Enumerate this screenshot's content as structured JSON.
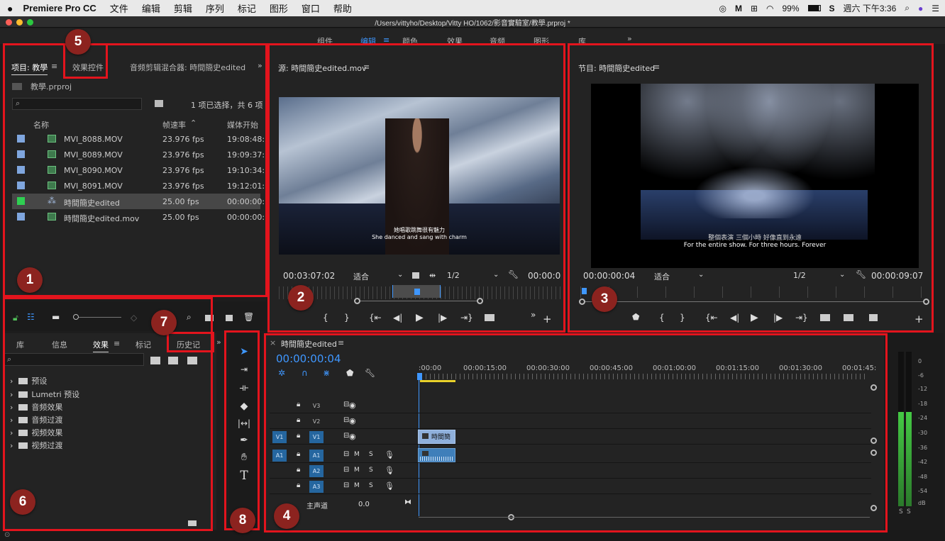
{
  "menubar": {
    "app": "Premiere Pro CC",
    "items": [
      "文件",
      "编辑",
      "剪辑",
      "序列",
      "标记",
      "图形",
      "窗口",
      "帮助"
    ],
    "battery": "99%",
    "clock": "週六 下午3:36"
  },
  "window": {
    "title": "/Users/vittyho/Desktop/Vitty HO/1062/影音實驗室/教學.prproj *"
  },
  "workspaces": [
    "组件",
    "编辑",
    "颜色",
    "效果",
    "音频",
    "图形",
    "库"
  ],
  "project": {
    "tabs": [
      "项目: 教學",
      "效果控件",
      "音频剪辑混合器: 時間簡史edited"
    ],
    "file": "教學.prproj",
    "search_placeholder": "",
    "selection_info": "1 项已选择，共 6 项",
    "columns": [
      "名称",
      "帧速率",
      "媒体开始"
    ],
    "rows": [
      {
        "name": "MVI_8088.MOV",
        "fps": "23.976 fps",
        "start": "19:08:48:"
      },
      {
        "name": "MVI_8089.MOV",
        "fps": "23.976 fps",
        "start": "19:09:37:"
      },
      {
        "name": "MVI_8090.MOV",
        "fps": "23.976 fps",
        "start": "19:10:34:"
      },
      {
        "name": "MVI_8091.MOV",
        "fps": "23.976 fps",
        "start": "19:12:01:"
      },
      {
        "name": "時間簡史edited",
        "fps": "25.00 fps",
        "start": "00:00:00:"
      },
      {
        "name": "時間簡史edited.mov",
        "fps": "25.00 fps",
        "start": "00:00:00:"
      }
    ]
  },
  "source": {
    "title": "源: 時間簡史edited.mov",
    "timecode": "00:03:07:02",
    "fit": "适合",
    "resolution": "1/2",
    "duration": "00:00:0",
    "subtitle_zh": "她唱歌跳舞很有魅力",
    "subtitle_en": "She danced and sang with charm"
  },
  "program": {
    "title": "节目: 時間簡史edited",
    "timecode": "00:00:00:04",
    "fit": "适合",
    "resolution": "1/2",
    "duration": "00:00:09:07",
    "subtitle_zh": "整個表演 三個小時 好像直到永遠",
    "subtitle_en": "For the entire show. For three hours. Forever"
  },
  "effects": {
    "tabs": [
      "库",
      "信息",
      "效果",
      "标记",
      "历史记"
    ],
    "folders": [
      "预设",
      "Lumetri 预设",
      "音频效果",
      "音频过渡",
      "视频效果",
      "视频过渡"
    ]
  },
  "timeline": {
    "title": "時間簡史edited",
    "timecode": "00:00:00:04",
    "ruler": [
      ":00:00",
      "00:00:15:00",
      "00:00:30:00",
      "00:00:45:00",
      "00:01:00:00",
      "00:01:15:00",
      "00:01:30:00",
      "00:01:45:"
    ],
    "video_tracks": [
      "V3",
      "V2",
      "V1"
    ],
    "audio_tracks": [
      "A1",
      "A2",
      "A3"
    ],
    "source_v": "V1",
    "source_a": "A1",
    "master_label": "主声道",
    "master_value": "0.0",
    "clip_label": "時間簡",
    "mute": "M",
    "solo": "S"
  },
  "meter": {
    "scale": [
      "0",
      "-6",
      "-12",
      "-18",
      "-24",
      "-30",
      "-36",
      "-42",
      "-48",
      "-54",
      "dB"
    ],
    "solo_labels": [
      "S",
      "S"
    ]
  },
  "annotations": [
    "1",
    "2",
    "3",
    "4",
    "5",
    "6",
    "7",
    "8"
  ],
  "colors": {
    "annotation": "#e3141d",
    "badge": "#8c231f",
    "accent_blue": "#3f97ff",
    "meter_green": "#3fb83f"
  }
}
